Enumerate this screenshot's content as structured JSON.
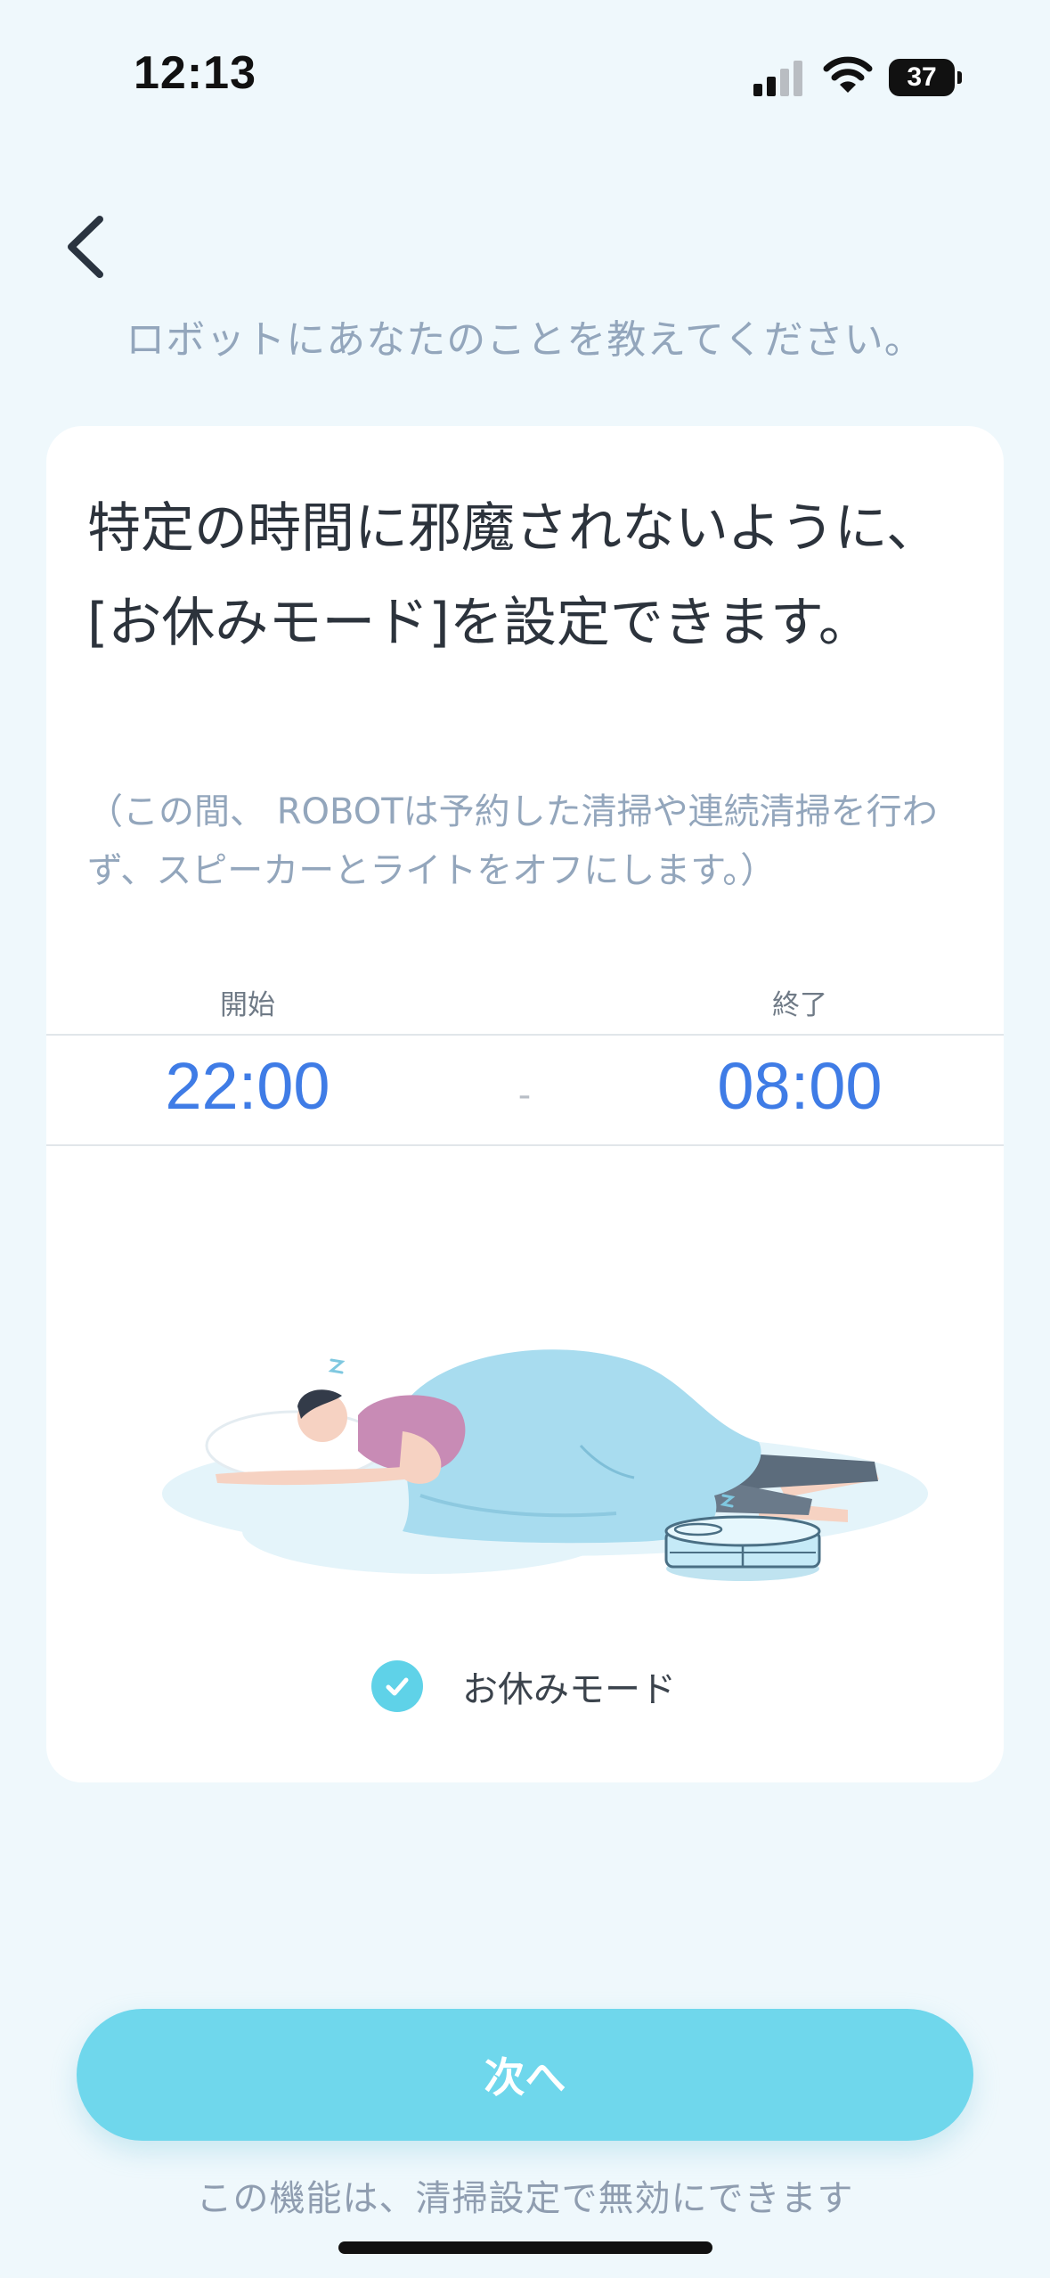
{
  "status_bar": {
    "time": "12:13",
    "battery_level": "37"
  },
  "header": {
    "subtitle": "ロボットにあなたのことを教えてください。"
  },
  "card": {
    "title": "特定の時間に邪魔されないように、[お休みモード]を設定できます。",
    "note": "（この間、 ROBOTは予約した清掃や連続清掃を行わず、スピーカーとライトをオフにします。）",
    "start_label": "開始",
    "end_label": "終了",
    "start_time": "22:00",
    "end_time": "08:00",
    "separator": "-",
    "checkbox_label": "お休みモード",
    "checkbox_checked": true
  },
  "footer": {
    "next_label": "次へ",
    "note": "この機能は、清掃設定で無効にできます"
  },
  "colors": {
    "accent_blue": "#3f7ce6",
    "button_cyan": "#6fd7ec",
    "check_cyan": "#5fd2e8",
    "background": "#eff8fc"
  },
  "icons": [
    "back-chevron-icon",
    "signal-icon",
    "wifi-icon",
    "battery-icon",
    "check-icon"
  ]
}
